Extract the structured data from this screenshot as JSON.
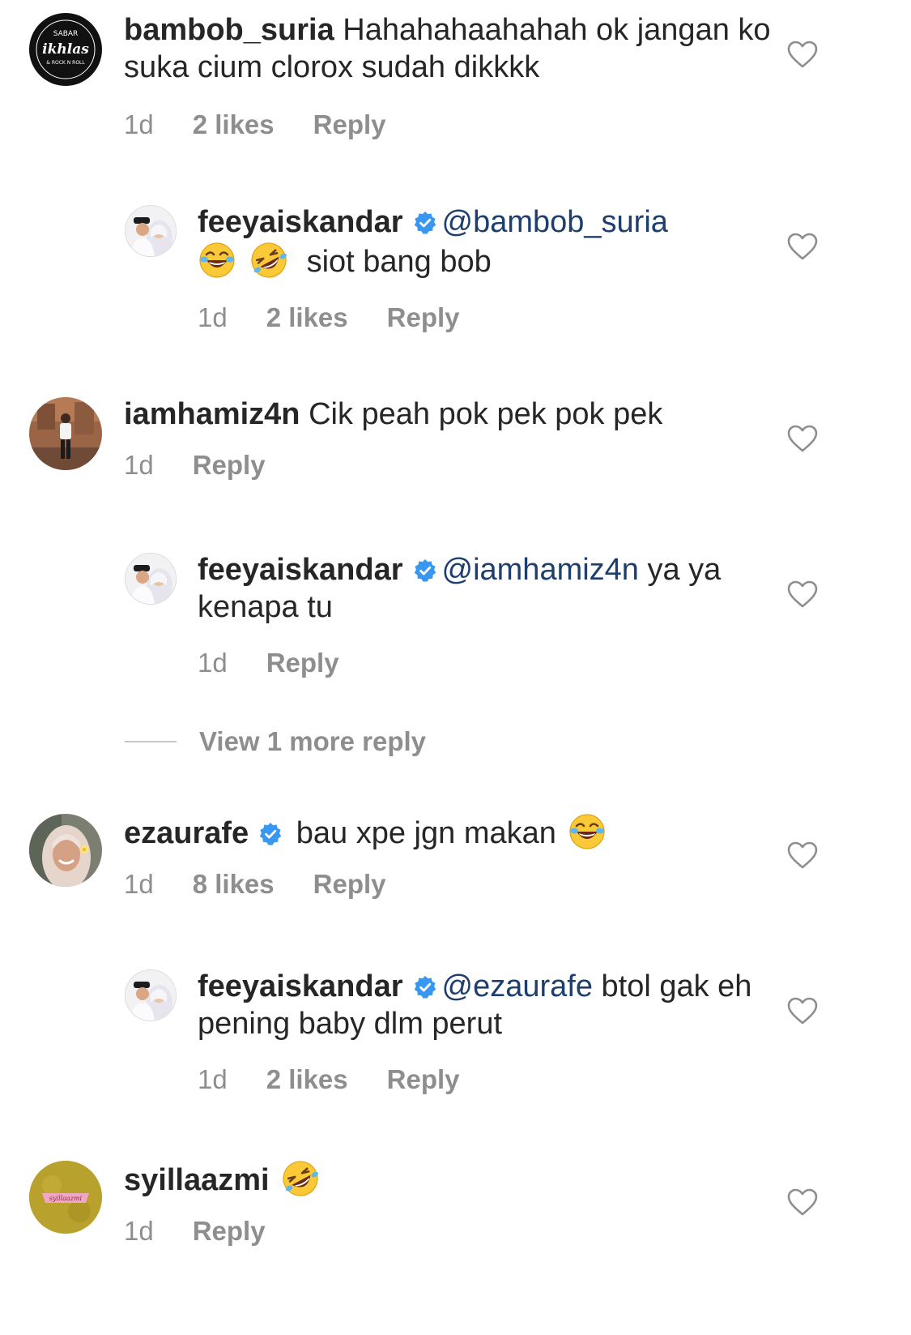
{
  "colors": {
    "text": "#262626",
    "meta": "#8e8e8e",
    "mention": "#1e3f6e",
    "verified": "#3897f0"
  },
  "comments": [
    {
      "username": "bambob_suria",
      "text_1": " Hahahahaahahah ok jangan ko suka cium clorox sudah dikkkk",
      "time": "1d",
      "likes": "2 likes",
      "reply": "Reply",
      "avatar_logo": "SABAR ikhlas & ROCK N ROLL"
    },
    {
      "username": "feeyaiskandar",
      "verified": true,
      "mention": "@bambob_suria",
      "emojis": [
        "joy-emoji",
        "rofl-emoji"
      ],
      "text_1": "siot bang bob",
      "time": "1d",
      "likes": "2 likes",
      "reply": "Reply"
    },
    {
      "username": "iamhamiz4n",
      "text_1": " Cik peah pok pek pok pek",
      "time": "1d",
      "reply": "Reply"
    },
    {
      "username": "feeyaiskandar",
      "verified": true,
      "mention": "@iamhamiz4n",
      "text_1": " ya ya kenapa tu",
      "time": "1d",
      "reply": "Reply"
    },
    {
      "username": "ezaurafe",
      "verified": true,
      "text_1": " bau xpe jgn makan ",
      "emojis": [
        "joy-emoji"
      ],
      "time": "1d",
      "likes": "8 likes",
      "reply": "Reply"
    },
    {
      "username": "feeyaiskandar",
      "verified": true,
      "mention": "@ezaurafe",
      "text_1": " btol gak eh pening baby dlm perut",
      "time": "1d",
      "likes": "2 likes",
      "reply": "Reply"
    },
    {
      "username": "syillaazmi",
      "emojis": [
        "rofl-emoji"
      ],
      "time": "1d",
      "reply": "Reply",
      "avatar_logo": "syillaazmi"
    }
  ],
  "view_more": "View 1 more reply"
}
